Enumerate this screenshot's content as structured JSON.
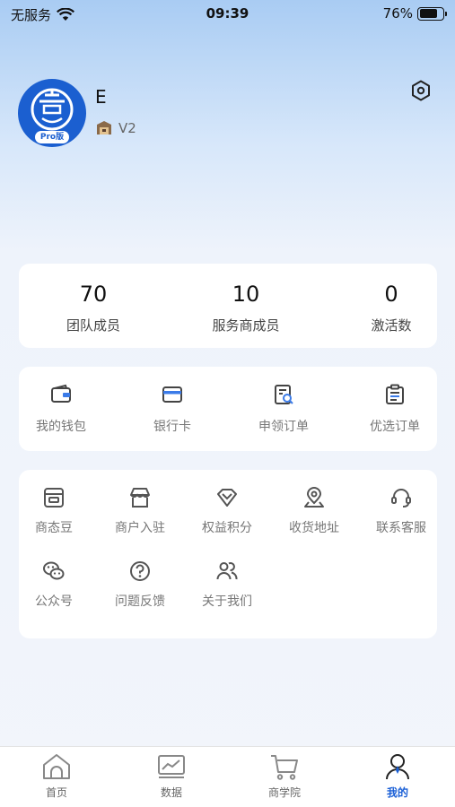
{
  "status_bar": {
    "carrier": "无服务",
    "time": "09:39",
    "battery": "76%",
    "battery_level": 0.76
  },
  "profile": {
    "name": "E",
    "badge": "Pro版",
    "level": "V2"
  },
  "stats": [
    {
      "value": "70",
      "label": "团队成员"
    },
    {
      "value": "10",
      "label": "服务商成员"
    },
    {
      "value": "0",
      "label": "激活数"
    }
  ],
  "quick_actions": [
    {
      "label": "我的钱包",
      "icon": "wallet-icon"
    },
    {
      "label": "银行卡",
      "icon": "bank-card-icon"
    },
    {
      "label": "申领订单",
      "icon": "claim-order-icon"
    },
    {
      "label": "优选订单",
      "icon": "preferred-order-icon"
    }
  ],
  "services": [
    {
      "label": "商态豆",
      "icon": "bean-box-icon"
    },
    {
      "label": "商户入驻",
      "icon": "store-icon"
    },
    {
      "label": "权益积分",
      "icon": "diamond-icon"
    },
    {
      "label": "收货地址",
      "icon": "location-icon"
    },
    {
      "label": "联系客服",
      "icon": "headset-icon"
    },
    {
      "label": "公众号",
      "icon": "wechat-icon"
    },
    {
      "label": "问题反馈",
      "icon": "question-icon"
    },
    {
      "label": "关于我们",
      "icon": "users-icon"
    }
  ],
  "tabs": [
    {
      "label": "首页",
      "icon": "home-icon"
    },
    {
      "label": "数据",
      "icon": "chart-icon"
    },
    {
      "label": "商学院",
      "icon": "cart-icon"
    },
    {
      "label": "我的",
      "icon": "profile-icon",
      "active": true
    }
  ],
  "colors": {
    "accent": "#1a5fd6",
    "avatar_bg": "#1b5fd0",
    "icon_gray": "#555555"
  }
}
